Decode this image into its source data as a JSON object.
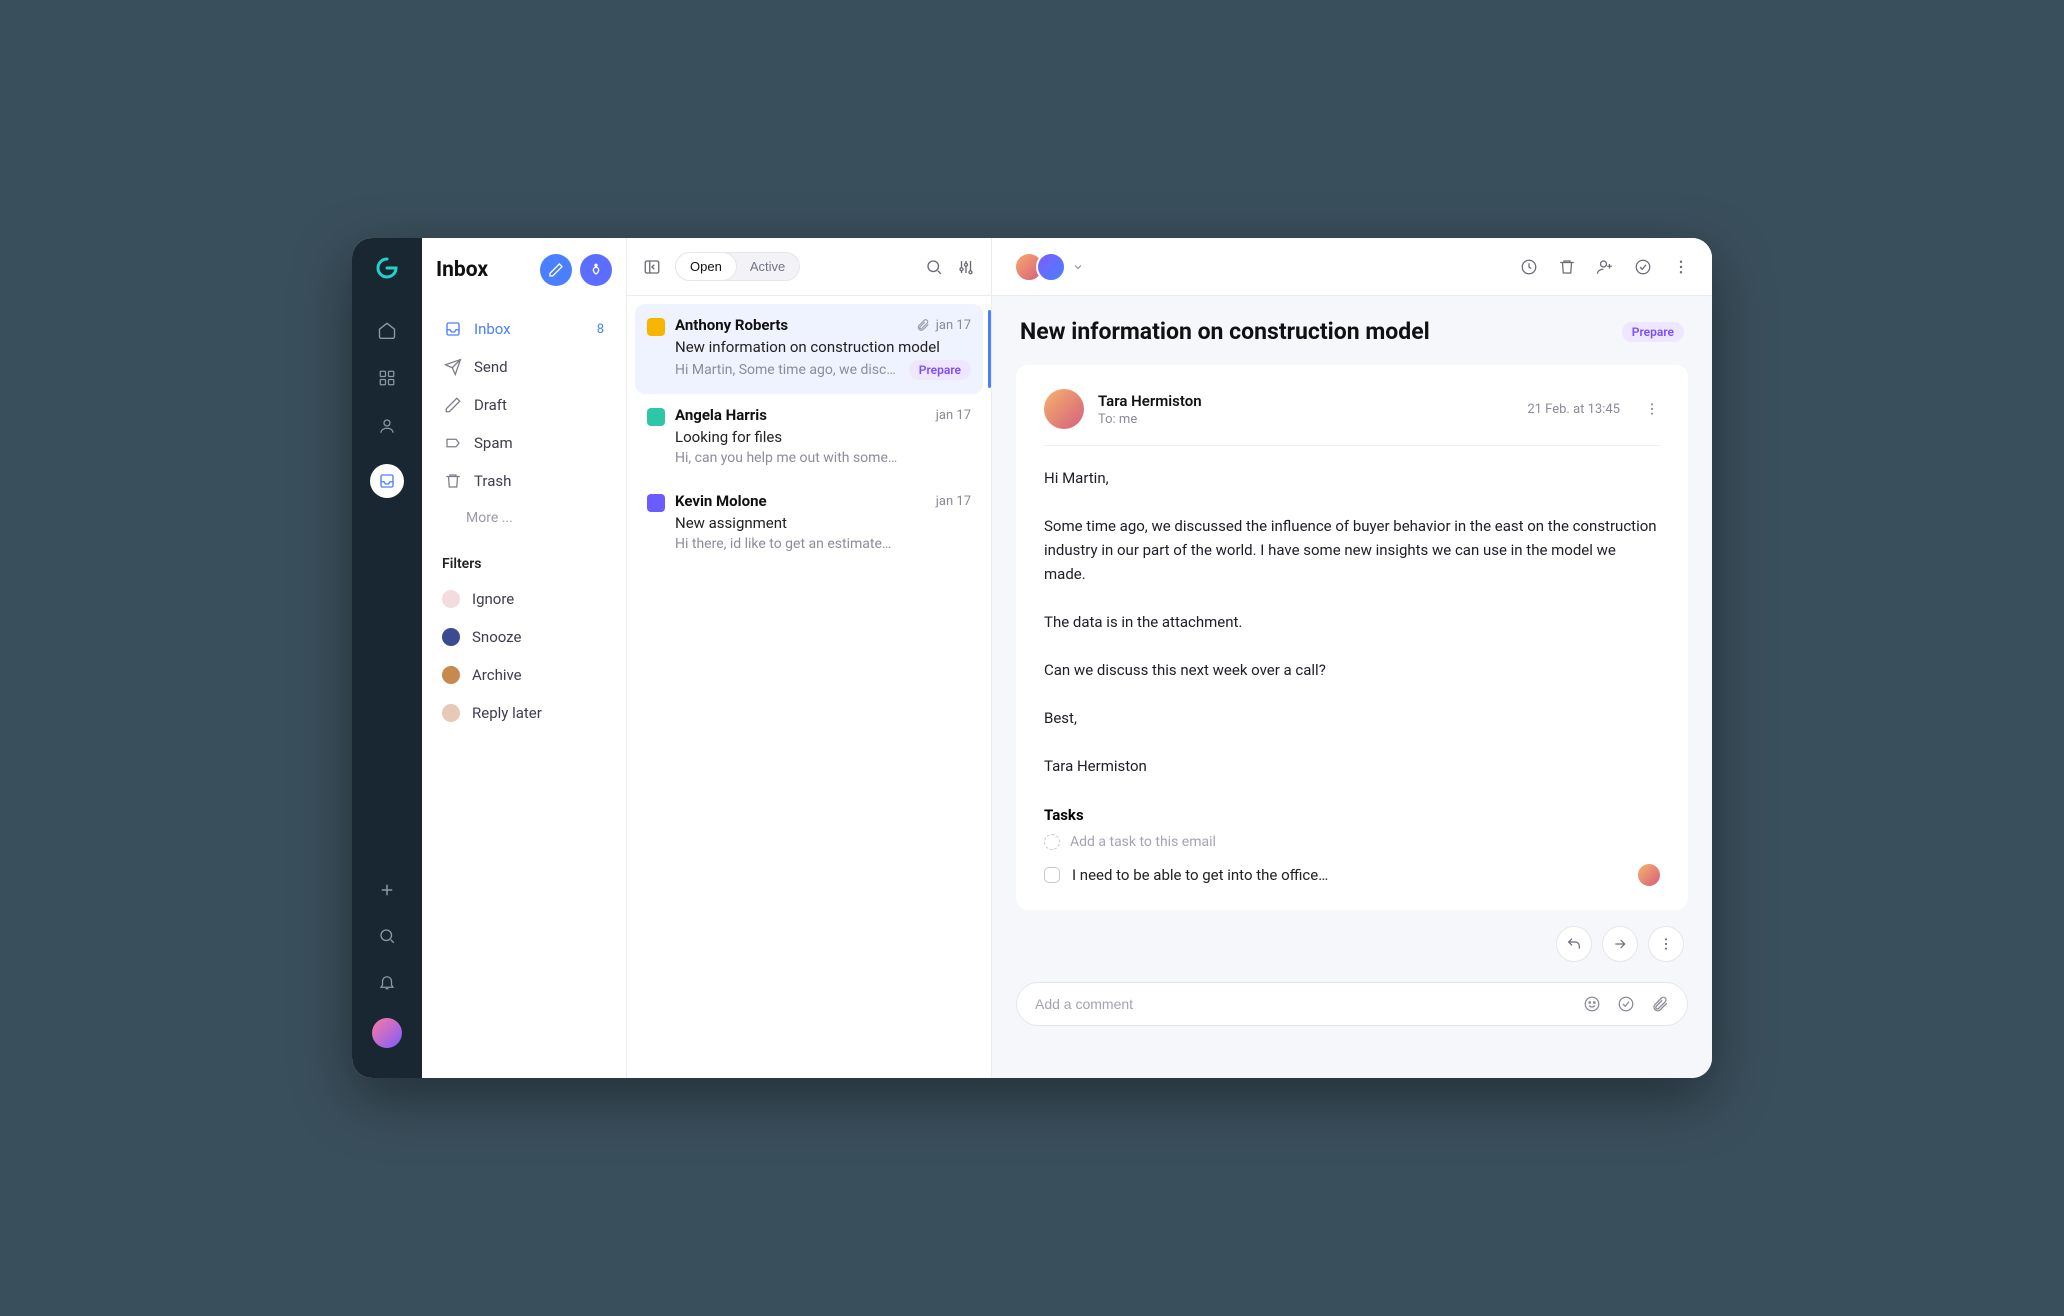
{
  "sidebar": {
    "title": "Inbox",
    "nav": [
      {
        "label": "Inbox",
        "count": "8"
      },
      {
        "label": "Send"
      },
      {
        "label": "Draft"
      },
      {
        "label": "Spam"
      },
      {
        "label": "Trash"
      }
    ],
    "more_label": "More ...",
    "filters_heading": "Filters",
    "filters": [
      {
        "label": "Ignore",
        "color": "#f4dbe0"
      },
      {
        "label": "Snooze",
        "color": "#3b4b8f"
      },
      {
        "label": "Archive",
        "color": "#c78a4e"
      },
      {
        "label": "Reply later",
        "color": "#e7c9b8"
      }
    ]
  },
  "list_toolbar": {
    "seg_open": "Open",
    "seg_active": "Active"
  },
  "conversations": [
    {
      "sender": "Anthony Roberts",
      "date": "jan 17",
      "subject": "New information on construction model",
      "preview": "Hi Martin, Some time ago, we disc…",
      "tag": "Prepare",
      "has_attachment": true,
      "avatar_color": "#f7b500"
    },
    {
      "sender": "Angela Harris",
      "date": "jan 17",
      "subject": "Looking for files",
      "preview": "Hi, can you help me out with some…",
      "avatar_color": "#2ec7a6"
    },
    {
      "sender": "Kevin Molone",
      "date": "jan 17",
      "subject": "New assignment",
      "preview": "Hi there, id like to get an estimate…",
      "avatar_color": "#6a5cff"
    }
  ],
  "reading": {
    "subject": "New information on construction model",
    "tag": "Prepare",
    "from_name": "Tara Hermiston",
    "to_line": "To: me",
    "date": "21 Feb. at 13:45",
    "body": "Hi Martin,\n\nSome time ago, we discussed the influence of buyer behavior in the east on the construction industry in our part of the world. I have some new insights we can use in the model we made.\n\nThe data is in the attachment.\n\nCan we discuss this next week over a call?\n\nBest,\n\nTara Hermiston",
    "tasks_heading": "Tasks",
    "add_task_placeholder": "Add a task to this email",
    "tasks": [
      {
        "label": "I need to be able to get into the office…"
      }
    ],
    "comment_placeholder": "Add a comment"
  }
}
